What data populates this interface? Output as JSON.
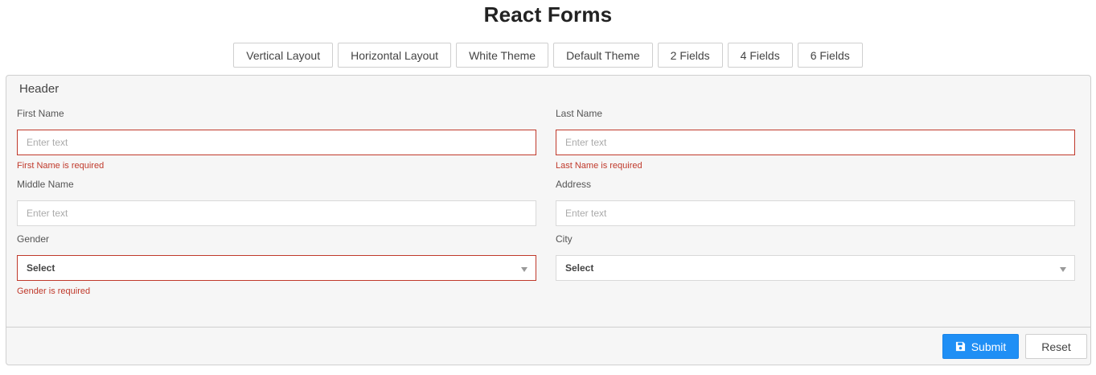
{
  "page": {
    "title": "React Forms"
  },
  "toolbar": {
    "buttons": [
      {
        "label": "Vertical Layout"
      },
      {
        "label": "Horizontal Layout"
      },
      {
        "label": "White Theme"
      },
      {
        "label": "Default Theme"
      },
      {
        "label": "2 Fields"
      },
      {
        "label": "4 Fields"
      },
      {
        "label": "6 Fields"
      }
    ]
  },
  "form": {
    "header": "Header",
    "first_name": {
      "label": "First Name",
      "placeholder": "Enter text",
      "value": "",
      "error": "First Name is required"
    },
    "last_name": {
      "label": "Last Name",
      "placeholder": "Enter text",
      "value": "",
      "error": "Last Name is required"
    },
    "middle_name": {
      "label": "Middle Name",
      "placeholder": "Enter text",
      "value": ""
    },
    "address": {
      "label": "Address",
      "placeholder": "Enter text",
      "value": ""
    },
    "gender": {
      "label": "Gender",
      "selected": "Select",
      "error": "Gender is required"
    },
    "city": {
      "label": "City",
      "selected": "Select"
    },
    "submit_label": "Submit",
    "reset_label": "Reset"
  },
  "colors": {
    "accent": "#1f8ff5",
    "error": "#c0392b",
    "panel_bg": "#f6f6f6"
  },
  "icons": {
    "submit_icon": "save-icon",
    "select_caret": "chevron-down-icon"
  }
}
